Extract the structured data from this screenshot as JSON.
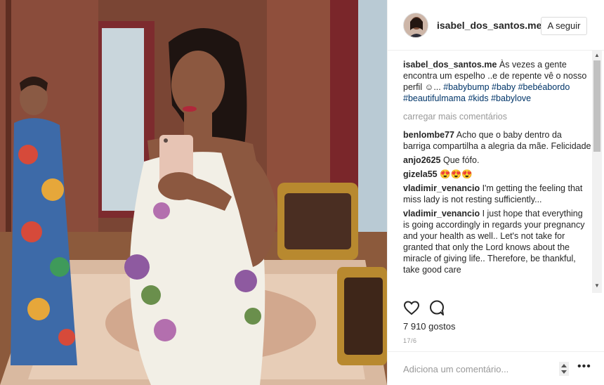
{
  "post": {
    "username": "isabel_dos_santos.me",
    "follow_label": "A seguir",
    "caption_user": "isabel_dos_santos.me",
    "caption_text": "Às vezes a gente encontra um espelho ..e de repente vê o nosso perfil ☺...",
    "hashtags": [
      "#babybump",
      "#baby",
      "#bebéabordo",
      "#beautifulmama",
      "#kids",
      "#babylove"
    ],
    "load_more": "carregar mais comentários",
    "comments": [
      {
        "user": "benlombe77",
        "text": "Acho que o baby dentro da barriga compartilha a alegria da mãe. Felicidade"
      },
      {
        "user": "anjo2625",
        "text": "Que fófo."
      },
      {
        "user": "gizela55",
        "text": "😍😍😍"
      },
      {
        "user": "vladimir_venancio",
        "text": "I'm getting the feeling that miss lady is not resting sufficiently..."
      },
      {
        "user": "vladimir_venancio",
        "text": "I just hope that everything is going accordingly in regards your pregnancy and your health as well.. Let's not take for granted that only the Lord knows about the miracle of giving life.. Therefore, be thankful, take good care"
      }
    ],
    "likes": "7 910 gostos",
    "date": "17/6",
    "comment_placeholder": "Adiciona um comentário...",
    "more_label": "•••"
  },
  "colors": {
    "text": "#262626",
    "muted": "#999999",
    "hashtag": "#003569",
    "border": "#efefef"
  }
}
